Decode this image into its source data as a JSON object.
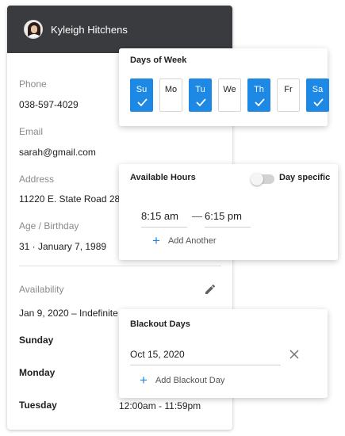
{
  "profile": {
    "name": "Kyleigh Hitchens",
    "phone_label": "Phone",
    "phone": "038-597-4029",
    "email_label": "Email",
    "email": "sarah@gmail.com",
    "address_label": "Address",
    "address": "11220 E. State Road 28",
    "age_label": "Age / Birthday",
    "age": "31 · January 7, 1989",
    "availability_label": "Availability",
    "availability_range": "Jan 9, 2020  –  Indefinite",
    "days": [
      "Sunday",
      "Monday",
      "Tuesday"
    ],
    "tuesday_hours": "12:00am  -  11:59pm"
  },
  "days_of_week": {
    "title": "Days of Week",
    "days": [
      {
        "label": "Su",
        "selected": true
      },
      {
        "label": "Mo",
        "selected": false
      },
      {
        "label": "Tu",
        "selected": true
      },
      {
        "label": "We",
        "selected": false
      },
      {
        "label": "Th",
        "selected": true
      },
      {
        "label": "Fr",
        "selected": false
      },
      {
        "label": "Sa",
        "selected": true
      }
    ]
  },
  "available_hours": {
    "title": "Available Hours",
    "toggle_label": "Day specific",
    "toggle_on": false,
    "start": "8:15 am",
    "separator": "—",
    "end": "6:15 pm",
    "add_label": "Add Another"
  },
  "blackout": {
    "title": "Blackout Days",
    "date": "Oct 15, 2020",
    "add_label": "Add Blackout Day"
  },
  "colors": {
    "accent": "#1e88e5",
    "header": "#3a3b3e"
  },
  "icons": {
    "edit": "pencil-icon",
    "clear": "close-icon",
    "add": "plus-icon",
    "check": "check-icon"
  }
}
